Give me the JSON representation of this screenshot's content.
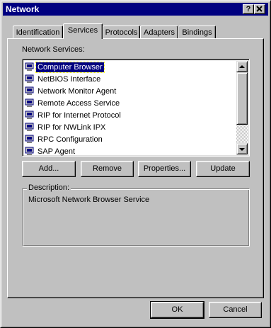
{
  "window": {
    "title": "Network",
    "help_button": "?",
    "close_button": "X"
  },
  "tabs": [
    {
      "label": "Identification"
    },
    {
      "label": "Services",
      "active": true
    },
    {
      "label": "Protocols"
    },
    {
      "label": "Adapters"
    },
    {
      "label": "Bindings"
    }
  ],
  "services": {
    "label": "Network Services:",
    "items": [
      {
        "label": "Computer Browser",
        "selected": true,
        "icon": "network-service-icon"
      },
      {
        "label": "NetBIOS Interface",
        "icon": "network-service-icon"
      },
      {
        "label": "Network Monitor Agent",
        "icon": "network-service-icon"
      },
      {
        "label": "Remote Access Service",
        "icon": "network-service-icon"
      },
      {
        "label": "RIP for Internet Protocol",
        "icon": "network-service-icon"
      },
      {
        "label": "RIP for NWLink IPX",
        "icon": "network-service-icon"
      },
      {
        "label": "RPC Configuration",
        "icon": "network-service-icon"
      },
      {
        "label": "SAP Agent",
        "icon": "network-service-icon"
      }
    ],
    "buttons": {
      "add": "Add...",
      "remove": "Remove",
      "properties": "Properties...",
      "update": "Update"
    }
  },
  "description": {
    "legend": "Description:",
    "text": "Microsoft Network Browser Service"
  },
  "footer": {
    "ok": "OK",
    "cancel": "Cancel"
  },
  "colors": {
    "titlebar": "#000080",
    "face": "#c0c0c0",
    "selection": "#000080"
  }
}
